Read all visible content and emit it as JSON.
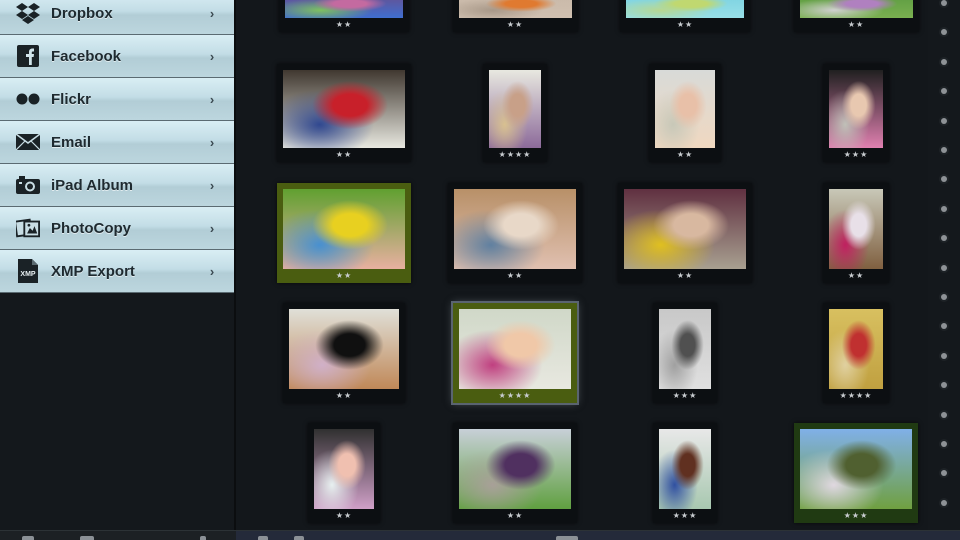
{
  "sidebar": {
    "items": [
      {
        "label": "Dropbox",
        "icon": "dropbox-icon"
      },
      {
        "label": "Facebook",
        "icon": "facebook-icon"
      },
      {
        "label": "Flickr",
        "icon": "flickr-icon"
      },
      {
        "label": "Email",
        "icon": "envelope-icon"
      },
      {
        "label": "iPad Album",
        "icon": "camera-icon"
      },
      {
        "label": "PhotoCopy",
        "icon": "photocopy-icon"
      },
      {
        "label": "XMP Export",
        "icon": "xmp-file-icon"
      }
    ],
    "chevron": "›",
    "xmp_text": "XMP"
  },
  "photos": [
    {
      "row": 0,
      "col": 0,
      "rating": 2,
      "stars": "★★",
      "frame": "dark",
      "colors": [
        "#6a4d8a",
        "#c46aa0",
        "#3f6ed0",
        "#7ec060"
      ]
    },
    {
      "row": 0,
      "col": 1,
      "rating": 2,
      "stars": "★★",
      "frame": "dark",
      "colors": [
        "#c8b8a8",
        "#e07a30",
        "#d0c0b0",
        "#a89888"
      ]
    },
    {
      "row": 0,
      "col": 2,
      "rating": 2,
      "stars": "★★",
      "frame": "dark",
      "colors": [
        "#78d0e0",
        "#c0d870",
        "#98e0e8",
        "#b8d890"
      ]
    },
    {
      "row": 0,
      "col": 3,
      "rating": 2,
      "stars": "★★",
      "frame": "dark",
      "colors": [
        "#5a9a40",
        "#b080c0",
        "#7ab050",
        "#d0d0d0"
      ]
    },
    {
      "row": 1,
      "col": 0,
      "rating": 2,
      "stars": "★★",
      "frame": "dark",
      "colors": [
        "#403830",
        "#c8202a",
        "#e8e8e0",
        "#304890"
      ]
    },
    {
      "row": 1,
      "col": 1,
      "rating": 4,
      "stars": "★★★★",
      "frame": "dark",
      "colors": [
        "#e8e8e0",
        "#c8a088",
        "#8c6a9a",
        "#d8c090"
      ]
    },
    {
      "row": 1,
      "col": 2,
      "rating": 2,
      "stars": "★★",
      "frame": "dark",
      "colors": [
        "#d8dad8",
        "#e8c0a8",
        "#f0d8c0",
        "#c8c8b8"
      ]
    },
    {
      "row": 1,
      "col": 3,
      "rating": 3,
      "stars": "★★★",
      "frame": "dark",
      "colors": [
        "#202020",
        "#e8c8b0",
        "#e080b0",
        "#c0c0b8"
      ]
    },
    {
      "row": 2,
      "col": 0,
      "rating": 2,
      "stars": "★★",
      "frame": "green",
      "colors": [
        "#60a030",
        "#e8d020",
        "#e8b0a0",
        "#4890d0"
      ]
    },
    {
      "row": 2,
      "col": 1,
      "rating": 2,
      "stars": "★★",
      "frame": "dark",
      "colors": [
        "#b89068",
        "#e8d8c8",
        "#e0c0b0",
        "#6080a0"
      ]
    },
    {
      "row": 2,
      "col": 2,
      "rating": 2,
      "stars": "★★",
      "frame": "dark",
      "colors": [
        "#603040",
        "#d8b8a0",
        "#a8a090",
        "#e0c020"
      ]
    },
    {
      "row": 2,
      "col": 3,
      "rating": 2,
      "stars": "★★",
      "frame": "dark",
      "colors": [
        "#c8c8b8",
        "#e8e0e8",
        "#806040",
        "#c02060"
      ]
    },
    {
      "row": 3,
      "col": 0,
      "rating": 2,
      "stars": "★★",
      "frame": "dark",
      "colors": [
        "#e0e0d8",
        "#101010",
        "#c08858",
        "#d0b0c8"
      ]
    },
    {
      "row": 3,
      "col": 1,
      "rating": 4,
      "stars": "★★★★",
      "frame": "green",
      "selected": true,
      "colors": [
        "#d0d8c8",
        "#f0c8a8",
        "#e8e8e0",
        "#c04080"
      ]
    },
    {
      "row": 3,
      "col": 2,
      "rating": 3,
      "stars": "★★★",
      "frame": "dark",
      "colors": [
        "#c8c8c8",
        "#505050",
        "#e0e0e0",
        "#a0a0a0"
      ]
    },
    {
      "row": 3,
      "col": 3,
      "rating": 4,
      "stars": "★★★★",
      "frame": "dark",
      "colors": [
        "#d8c060",
        "#c03030",
        "#c0a040",
        "#e0d0a0"
      ]
    },
    {
      "row": 4,
      "col": 0,
      "rating": 2,
      "stars": "★★",
      "frame": "dark",
      "colors": [
        "#303030",
        "#f0c0b0",
        "#d0a0c8",
        "#e8f0f0"
      ]
    },
    {
      "row": 4,
      "col": 1,
      "rating": 2,
      "stars": "★★",
      "frame": "dark",
      "colors": [
        "#c8d0d8",
        "#503060",
        "#60a040",
        "#a8a098"
      ]
    },
    {
      "row": 4,
      "col": 2,
      "rating": 3,
      "stars": "★★★",
      "frame": "dark",
      "colors": [
        "#e8e8e8",
        "#603020",
        "#a8c8b0",
        "#3050a0"
      ]
    },
    {
      "row": 4,
      "col": 3,
      "rating": 3,
      "stars": "★★★",
      "frame": "darkgreen",
      "colors": [
        "#80b0e8",
        "#506030",
        "#70a040",
        "#e0d8e0"
      ]
    }
  ],
  "scroll_dots": 18,
  "status": {
    "selected_photo_rating": 4
  }
}
